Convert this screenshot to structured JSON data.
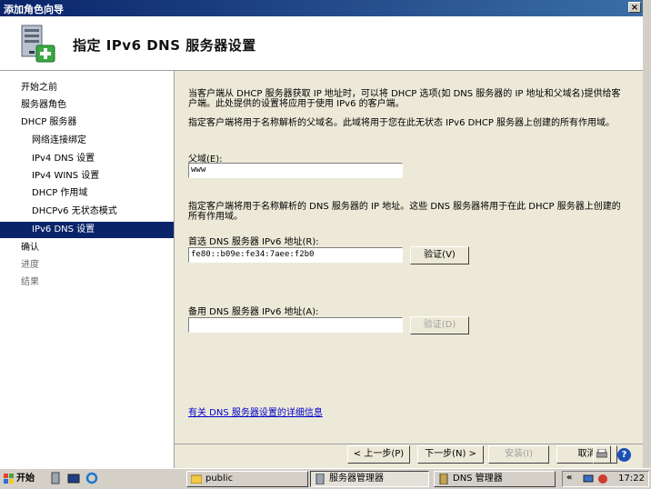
{
  "window": {
    "title": "添加角色向导",
    "close_glyph": "×"
  },
  "header": {
    "title": "指定 IPv6 DNS 服务器设置",
    "icon": "server-wizard-icon"
  },
  "nav": {
    "items": [
      {
        "label": "开始之前",
        "level": 0,
        "state": "normal"
      },
      {
        "label": "服务器角色",
        "level": 0,
        "state": "normal"
      },
      {
        "label": "DHCP 服务器",
        "level": 0,
        "state": "normal"
      },
      {
        "label": "网络连接绑定",
        "level": 1,
        "state": "normal"
      },
      {
        "label": "IPv4 DNS 设置",
        "level": 1,
        "state": "normal"
      },
      {
        "label": "IPv4 WINS 设置",
        "level": 1,
        "state": "normal"
      },
      {
        "label": "DHCP 作用域",
        "level": 1,
        "state": "normal"
      },
      {
        "label": "DHCPv6 无状态模式",
        "level": 1,
        "state": "normal"
      },
      {
        "label": "IPv6 DNS 设置",
        "level": 1,
        "state": "selected"
      },
      {
        "label": "确认",
        "level": 0,
        "state": "normal"
      },
      {
        "label": "进度",
        "level": 0,
        "state": "disabled"
      },
      {
        "label": "结果",
        "level": 0,
        "state": "disabled"
      }
    ]
  },
  "content": {
    "intro": "当客户端从 DHCP 服务器获取 IP 地址时，可以将 DHCP 选项(如 DNS 服务器的 IP 地址和父域名)提供给客户端。此处提供的设置将应用于使用 IPv6 的客户端。",
    "parent_domain_desc": "指定客户端将用于名称解析的父域名。此域将用于您在此无状态 IPv6 DHCP 服务器上创建的所有作用域。",
    "parent_domain_label": "父域(E):",
    "parent_domain_value": "www",
    "dns_desc": "指定客户端将用于名称解析的 DNS 服务器的 IP 地址。这些 DNS 服务器将用于在此 DHCP 服务器上创建的所有作用域。",
    "preferred_label": "首选 DNS 服务器 IPv6 地址(R):",
    "preferred_value": "fe80::b09e:fe34:7aee:f2b0",
    "verify_label": "验证(V)",
    "alternate_label": "备用 DNS 服务器 IPv6 地址(A):",
    "alternate_value": "",
    "verify2_label": "验证(D)",
    "more_info_link": "有关 DNS 服务器设置的详细信息"
  },
  "footer": {
    "back": "< 上一步(P)",
    "next": "下一步(N) >",
    "install": "安装(I)",
    "cancel": "取消"
  },
  "taskbar": {
    "start": "开始",
    "tasks": [
      {
        "label": "public",
        "icon": "folder-icon"
      },
      {
        "label": "服务器管理器",
        "icon": "server-manager-icon"
      },
      {
        "label": "DNS 管理器",
        "icon": "dns-manager-icon"
      }
    ],
    "tray_expand": "«",
    "clock": "17:22"
  },
  "colors": {
    "title_gradient_start": "#0a246a",
    "title_gradient_end": "#3a6ea5",
    "selected_nav": "#0a246a",
    "dialog_bg": "#ece9d8",
    "link": "#0000cc"
  }
}
